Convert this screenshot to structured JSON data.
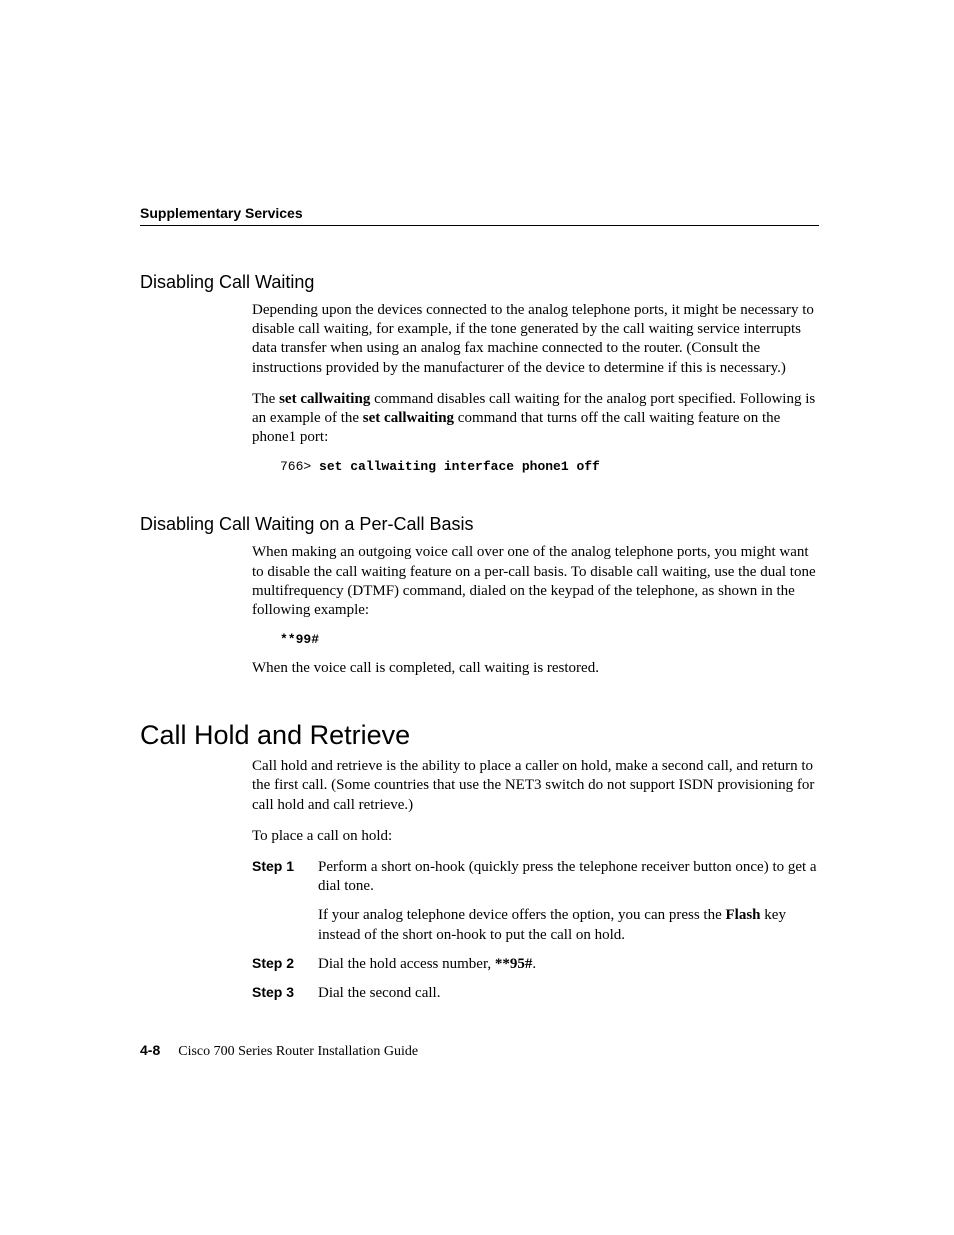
{
  "header": {
    "running": "Supplementary Services"
  },
  "sec1": {
    "title": "Disabling Call Waiting",
    "p1": "Depending upon the devices connected to the analog telephone ports, it might be necessary to disable call waiting, for example, if the tone generated by the call waiting service interrupts data transfer when using an analog fax machine connected to the router. (Consult the instructions provided by the manufacturer of the device to determine if this is necessary.)",
    "p2a": "The ",
    "p2b": "set callwaiting",
    "p2c": " command disables call waiting for the analog port specified. Following is an example of the ",
    "p2d": "set callwaiting",
    "p2e": " command that turns off the call waiting feature on the phone1 port:",
    "code_prompt": "766> ",
    "code_cmd": "set callwaiting interface phone1 off"
  },
  "sec2": {
    "title": "Disabling Call Waiting on a Per-Call Basis",
    "p1": "When making an outgoing voice call over one of the analog telephone ports, you might want to disable the call waiting feature on a per-call basis. To disable call waiting, use the dual tone multifrequency (DTMF) command, dialed on the keypad of the telephone, as shown in the following example:",
    "code": "**99#",
    "p2": "When the voice call is completed, call waiting is restored."
  },
  "sec3": {
    "title": "Call Hold and Retrieve",
    "p1": "Call hold and retrieve is the ability to place a caller on hold, make a second call, and return to the first call. (Some countries that use the NET3 switch do not support ISDN provisioning for call hold and call retrieve.)",
    "p2": "To place a call on hold:",
    "steps": [
      {
        "label": "Step 1",
        "text": "Perform a short on-hook (quickly press the telephone receiver button once) to get a dial tone.",
        "sub_a": "If your analog telephone device offers the option, you can press the ",
        "sub_b": "Flash",
        "sub_c": " key instead of the short on-hook to put the call on hold."
      },
      {
        "label": "Step 2",
        "text_a": "Dial the hold access number, ",
        "text_b": "**95#",
        "text_c": "."
      },
      {
        "label": "Step 3",
        "text": "Dial the second call."
      }
    ]
  },
  "footer": {
    "pagenum": "4-8",
    "title": "Cisco 700 Series Router Installation Guide"
  }
}
